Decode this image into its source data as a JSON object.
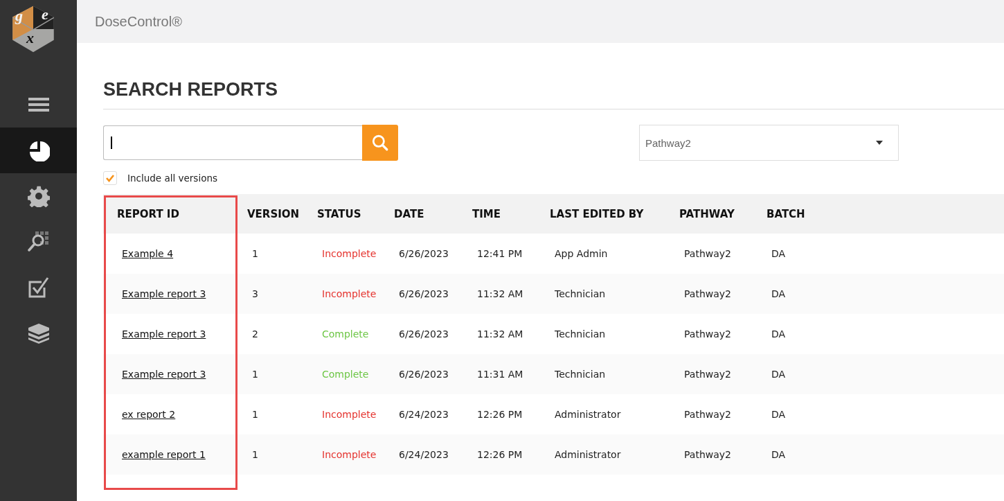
{
  "logo": {
    "letters": [
      "g",
      "e",
      "x"
    ]
  },
  "sidebar": {
    "items": [
      {
        "kind": "menu",
        "selected": false
      },
      {
        "kind": "dashboard",
        "selected": true
      },
      {
        "kind": "settings",
        "selected": false
      },
      {
        "kind": "search-grid",
        "selected": false
      },
      {
        "kind": "checklist",
        "selected": false
      },
      {
        "kind": "layers",
        "selected": false
      }
    ]
  },
  "app_title": "DoseControl®",
  "page_title": "SEARCH REPORTS",
  "search": {
    "focused": true
  },
  "dropdown": {
    "value": "Pathway2"
  },
  "include_all_versions": {
    "label": "Include all versions",
    "checked": true
  },
  "table": {
    "columns": [
      {
        "label": "REPORT ID",
        "highlighted": true
      },
      {
        "label": "VERSION",
        "highlighted": false
      },
      {
        "label": "STATUS",
        "highlighted": false
      },
      {
        "label": "DATE",
        "highlighted": false
      },
      {
        "label": "TIME",
        "highlighted": false
      },
      {
        "label": "LAST EDITED BY",
        "highlighted": false
      },
      {
        "label": "PATHWAY",
        "highlighted": false
      },
      {
        "label": "BATCH",
        "highlighted": false
      }
    ],
    "rows": [
      {
        "report_id": "Example 4",
        "version": "1",
        "status": "Incomplete",
        "color": "#e5322d",
        "date": "6/26/2023",
        "time": "12:41 PM",
        "last_edited_by": "App Admin",
        "pathway": "Pathway2",
        "batch": "DA"
      },
      {
        "report_id": "Example report 3",
        "version": "3",
        "status": "Incomplete",
        "color": "#e5322d",
        "date": "6/26/2023",
        "time": "11:32 AM",
        "last_edited_by": "Technician",
        "pathway": "Pathway2",
        "batch": "DA"
      },
      {
        "report_id": "Example report 3",
        "version": "2",
        "status": "Complete",
        "color": "#6cc644",
        "date": "6/26/2023",
        "time": "11:32 AM",
        "last_edited_by": "Technician",
        "pathway": "Pathway2",
        "batch": "DA"
      },
      {
        "report_id": "Example report 3",
        "version": "1",
        "status": "Complete",
        "color": "#6cc644",
        "date": "6/26/2023",
        "time": "11:31 AM",
        "last_edited_by": "Technician",
        "pathway": "Pathway2",
        "batch": "DA"
      },
      {
        "report_id": "ex report 2",
        "version": "1",
        "status": "Incomplete",
        "color": "#e5322d",
        "date": "6/24/2023",
        "time": "12:26 PM",
        "last_edited_by": "Administrator",
        "pathway": "Pathway2",
        "batch": "DA"
      },
      {
        "report_id": "example report 1",
        "version": "1",
        "status": "Incomplete",
        "color": "#e5322d",
        "date": "6/24/2023",
        "time": "12:26 PM",
        "last_edited_by": "Administrator",
        "pathway": "Pathway2",
        "batch": "DA"
      }
    ]
  }
}
